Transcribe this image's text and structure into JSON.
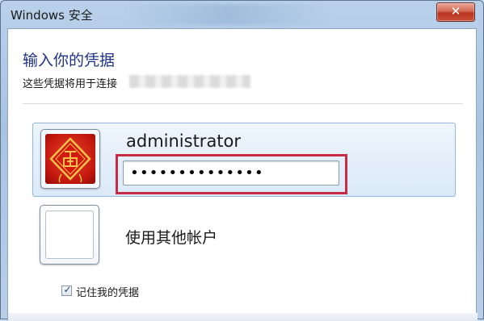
{
  "window": {
    "title": "Windows 安全",
    "close_glyph": "✕"
  },
  "dialog": {
    "heading": "输入你的凭据",
    "subtext": "这些凭据将用于连接"
  },
  "account": {
    "username": "administrator",
    "password_mask": "••••••••••••••",
    "avatar_icon": "fu-character-avatar-icon"
  },
  "other_account": {
    "label": "使用其他帐户",
    "icon": "blank-user-tile-icon"
  },
  "remember": {
    "label": "记住我的凭据",
    "checked": true,
    "check_glyph": "✓"
  },
  "colors": {
    "highlight": "#c72c43",
    "heading": "#1e3287",
    "selected_tile": "#dbe9f8"
  }
}
